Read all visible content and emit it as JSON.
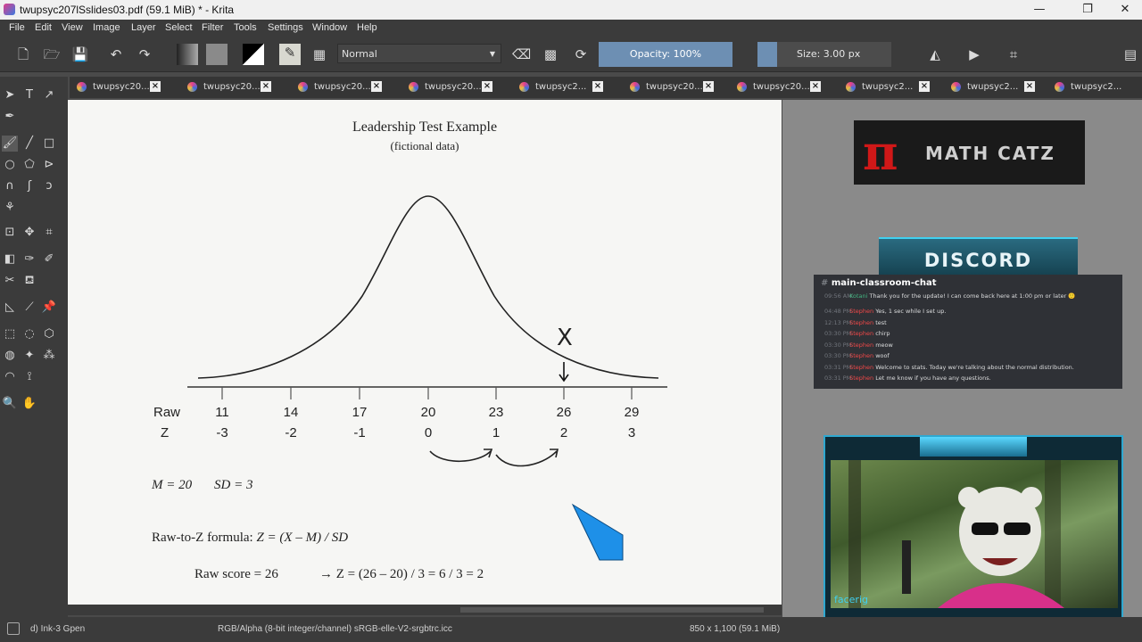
{
  "window": {
    "title": "twupsyc207lSslides03.pdf (59.1 MiB)  * - Krita",
    "minimize": "—",
    "maximize": "❐",
    "close": "✕"
  },
  "menu": [
    "File",
    "Edit",
    "View",
    "Image",
    "Layer",
    "Select",
    "Filter",
    "Tools",
    "Settings",
    "Window",
    "Help"
  ],
  "toolbar": {
    "blend_mode": "Normal",
    "opacity": "Opacity: 100%",
    "size": "Size: 3.00 px"
  },
  "tabs": [
    "twupsyc20...",
    "twupsyc20...",
    "twupsyc20...",
    "twupsyc20...",
    "twupsyc2...",
    "twupsyc20...",
    "twupsyc20...",
    "twupsyc2...",
    "twupsyc2...",
    "twupsyc2..."
  ],
  "slide": {
    "title": "Leadership Test Example",
    "subtitle": "(fictional data)",
    "raw_label": "Raw",
    "z_label": "Z",
    "raw_values": [
      "11",
      "14",
      "17",
      "20",
      "23",
      "26",
      "29"
    ],
    "z_values": [
      "-3",
      "-2",
      "-1",
      "0",
      "1",
      "2",
      "3"
    ],
    "marker": "X",
    "stats": {
      "m": "M = 20",
      "sd": "SD = 3"
    },
    "formula_prefix": "Raw-to-Z formula: ",
    "formula": "Z = (X – M) / SD",
    "example_raw": "Raw score = 26",
    "example_calc": "→ Z = (26 – 20) / 3 = 6 / 3 = 2"
  },
  "overlay": {
    "logo_text": "MATH CATZ",
    "logo_symbol": "π",
    "discord_banner": "DISCORD",
    "channel": "main-classroom-chat",
    "channel_hash": "#",
    "messages": [
      {
        "time": "09:56 AM",
        "user": "Kotani",
        "text": "Thank you for the update! I can come back here at 1:00 pm or later 🙂",
        "user_color": "green"
      },
      {
        "time": "04:48 PM",
        "user": "Stephen",
        "text": "Yes, 1 sec while I set up.",
        "user_color": "red"
      },
      {
        "time": "12:13 PM",
        "user": "Stephen",
        "text": "test",
        "user_color": "red"
      },
      {
        "time": "03:30 PM",
        "user": "Stephen",
        "text": "chirp",
        "user_color": "red"
      },
      {
        "time": "03:30 PM",
        "user": "Stephen",
        "text": "meow",
        "user_color": "red"
      },
      {
        "time": "03:30 PM",
        "user": "Stephen",
        "text": "woof",
        "user_color": "red"
      },
      {
        "time": "03:31 PM",
        "user": "Stephen",
        "text": "Welcome to stats. Today we're talking about the normal distribution.",
        "user_color": "red"
      },
      {
        "time": "03:31 PM",
        "user": "Stephen",
        "text": "Let me know if you have any questions.",
        "user_color": "red"
      }
    ],
    "webcam_label": "facerig"
  },
  "status": {
    "brush": "d) Ink-3 Gpen",
    "color_space": "RGB/Alpha (8-bit integer/channel)  sRGB-elle-V2-srgbtrc.icc",
    "dimensions": "850 x 1,100 (59.1 MiB)"
  },
  "colors": {
    "accent": "#6d8fb3",
    "panel": "#3b3b3b",
    "canvas": "#f6f6f4",
    "discord_red": "#f04747",
    "discord_green": "#43b581",
    "logo_red": "#d01818"
  }
}
